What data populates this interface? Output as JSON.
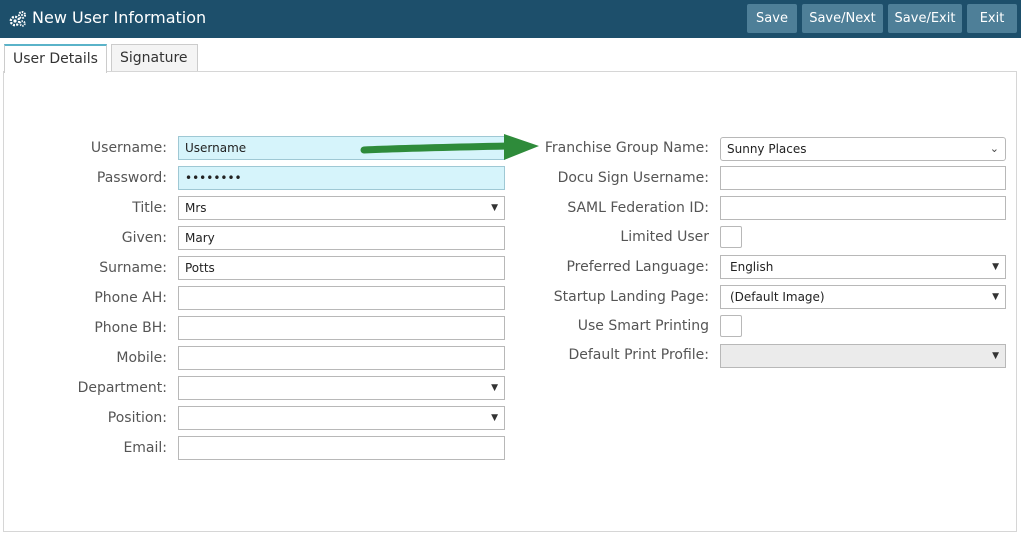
{
  "header": {
    "title": "New User Information",
    "icon": "gears-icon",
    "buttons": {
      "save": "Save",
      "save_next": "Save/Next",
      "save_exit": "Save/Exit",
      "exit": "Exit"
    }
  },
  "tabs": [
    {
      "label": "User Details",
      "active": true
    },
    {
      "label": "Signature",
      "active": false
    }
  ],
  "left": {
    "username": {
      "label": "Username:",
      "value": "Username"
    },
    "password": {
      "label": "Password:",
      "value": "••••••••"
    },
    "title": {
      "label": "Title:",
      "value": "Mrs"
    },
    "given": {
      "label": "Given:",
      "value": "Mary"
    },
    "surname": {
      "label": "Surname:",
      "value": "Potts"
    },
    "phone_ah": {
      "label": "Phone AH:",
      "value": ""
    },
    "phone_bh": {
      "label": "Phone BH:",
      "value": ""
    },
    "mobile": {
      "label": "Mobile:",
      "value": ""
    },
    "department": {
      "label": "Department:",
      "value": ""
    },
    "position": {
      "label": "Position:",
      "value": ""
    },
    "email": {
      "label": "Email:",
      "value": ""
    }
  },
  "right": {
    "franchise_group": {
      "label": "Franchise Group Name:",
      "value": "Sunny Places"
    },
    "docusign": {
      "label": "Docu Sign Username:",
      "value": ""
    },
    "saml": {
      "label": "SAML Federation ID:",
      "value": ""
    },
    "limited_user": {
      "label": "Limited User",
      "checked": false
    },
    "language": {
      "label": "Preferred Language:",
      "value": "English"
    },
    "landing": {
      "label": "Startup Landing Page:",
      "value": "(Default Image)"
    },
    "smart_printing": {
      "label": "Use Smart Printing",
      "checked": false
    },
    "print_profile": {
      "label": "Default Print Profile:",
      "value": ""
    }
  },
  "colors": {
    "header_bg": "#1d4f6b",
    "button_bg": "#4e7f98",
    "highlight_field": "#d6f4fb",
    "arrow": "#2e8b3a"
  }
}
